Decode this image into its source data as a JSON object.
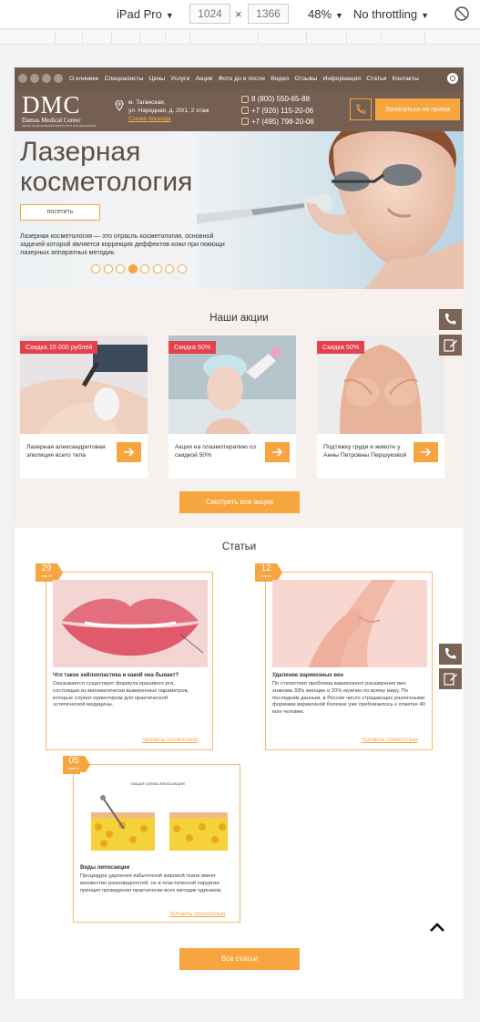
{
  "devtools": {
    "device": "iPad Pro",
    "width": "1024",
    "times": "×",
    "height": "1366",
    "zoom": "48%",
    "throttling": "No throttling"
  },
  "nav": {
    "items": [
      "О клинике",
      "Специалисты",
      "Цены",
      "Услуги",
      "Акции",
      "Фото до и после",
      "Видео",
      "Отзывы",
      "Информация",
      "Статьи",
      "Контакты"
    ]
  },
  "header": {
    "logo": "DMC",
    "logo_sub": "Damas Medical Center",
    "logo_tagline": "ЦЕНТР ЭСТЕТИЧЕСКОЙ ХИРУРГИИ И КОСМЕТОЛОГИИ",
    "address_line1": "м. Таганская,",
    "address_line2": "ул. Народная, д. 20/1, 2 этаж",
    "map_link": "Схема проезда",
    "phones": [
      "8 (800) 550-65-88",
      "+7 (926) 115-20-06",
      "+7 (495) 798-20-06"
    ],
    "signup": "Записаться на прием"
  },
  "hero": {
    "title_line1": "Лазерная",
    "title_line2": "косметология",
    "button": "посетить",
    "description": "Лазерная косметология — это отрасль косметологии, основной задачей которой является коррекция деффектов кожи при помощи лазерных аппаратных методик.",
    "slides": 8,
    "active_slide": 4
  },
  "promos": {
    "title": "Наши акции",
    "items": [
      {
        "badge": "Скидка 15 000 рублей",
        "text": "Лазерная александритовая эпиляция всего тела"
      },
      {
        "badge": "Скидка 50%",
        "text": "Акция на плазмотерапию со скидкой 50%"
      },
      {
        "badge": "Скидка 50%",
        "text": "Подтяжку груди и животе у Анны Петровны Першуковой"
      }
    ],
    "all_button": "Смотреть все акции"
  },
  "articles": {
    "title": "Статьи",
    "items": [
      {
        "day": "29",
        "month": "марта",
        "heading": "Что такое хейлопластика и какой она бывает?",
        "body": "Оказывается существует формула красивого рта, состоящая из математически выверенных параметров, которые служат ориентиром для практической эстетической медицины.",
        "more": "Читать полностью"
      },
      {
        "day": "12",
        "month": "марта",
        "heading": "Удаление варикозных вен",
        "body": "По статистике проблема варикозного расширения вен знакома 33% женщин и 20% мужчин по всему миру. По последним данным, в России число страдающих различными формами варикозной болезни уже приблизилось к отметке 40 млн человек.",
        "more": "Читать полностью"
      },
      {
        "day": "05",
        "month": "марта",
        "heading": "Виды липосакции",
        "body": "Процедура удаления избыточной жировой ткани имеет множество разновидностей, но в пластической хирургии принцип проведения практически всех методик одинаков.",
        "more": "Читать полностью",
        "diagram_title": "ОБЩАЯ СХЕМА ЛИПОСАКЦИИ"
      }
    ],
    "all_button": "Все статьи"
  },
  "colors": {
    "brown": "#6e5a4e",
    "orange": "#f7a53e",
    "red_badge": "#e5414b"
  }
}
